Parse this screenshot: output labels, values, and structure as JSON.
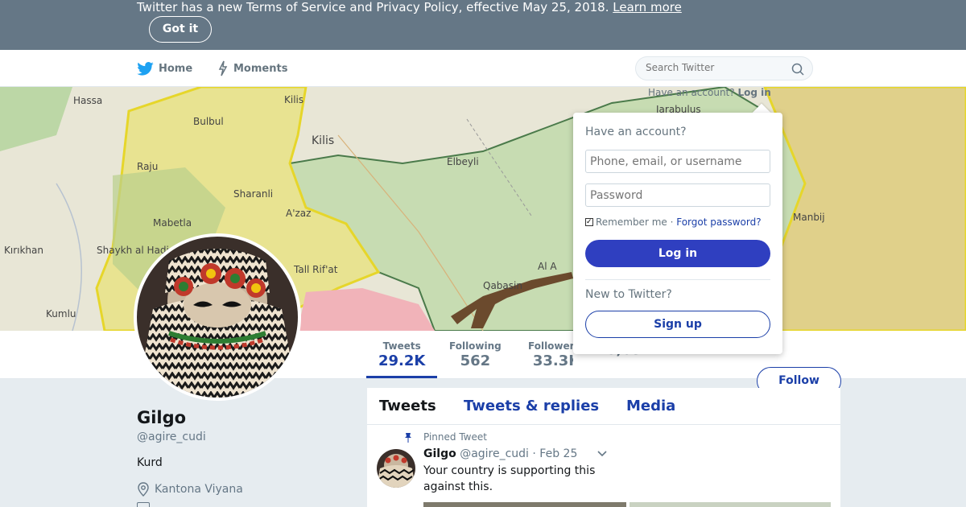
{
  "banner": {
    "text": "Twitter has a new Terms of Service and Privacy Policy, effective May 25, 2018.",
    "link": "Learn more",
    "button": "Got it"
  },
  "nav": {
    "home": "Home",
    "moments": "Moments",
    "search_placeholder": "Search Twitter",
    "have_account": "Have an account?",
    "login_link": "Log in"
  },
  "cover": {
    "labels": [
      "Hassa",
      "Bulbul",
      "Raju",
      "Kilis",
      "Kilis",
      "Sharanli",
      "A'zaz",
      "Elbeyli",
      "Kırıkhan",
      "Shaykh al Hadid",
      "Mabetla",
      "Tall Rif'at",
      "Qabasin",
      "Al A",
      "Kumlu",
      "Jarabulus",
      "Manbij"
    ]
  },
  "stats": [
    {
      "label": "Tweets",
      "value": "29.2K"
    },
    {
      "label": "Following",
      "value": "562"
    },
    {
      "label": "Followers",
      "value": "33.3K"
    },
    {
      "label": "",
      "value": "8,031"
    }
  ],
  "follow_button": "Follow",
  "profile": {
    "name": "Gilgo",
    "handle": "@agire_cudi",
    "bio": "Kurd",
    "location": "Kantona Viyana"
  },
  "timeline": {
    "tabs": [
      "Tweets",
      "Tweets & replies",
      "Media"
    ],
    "pinned_label": "Pinned Tweet",
    "tweet": {
      "name": "Gilgo",
      "handle": "@agire_cudi",
      "date": "· Feb 25",
      "text": "Your country is supporting this against this."
    }
  },
  "login": {
    "title": "Have an account?",
    "username_placeholder": "Phone, email, or username",
    "password_placeholder": "Password",
    "remember": "Remember me",
    "separator": " · ",
    "forgot": "Forgot password?",
    "login_button": "Log in",
    "new_title": "New to Twitter?",
    "signup_button": "Sign up"
  },
  "colors": {
    "banner": "#657786",
    "accent": "#1b3fa8",
    "login_button": "#2f3fc0"
  }
}
